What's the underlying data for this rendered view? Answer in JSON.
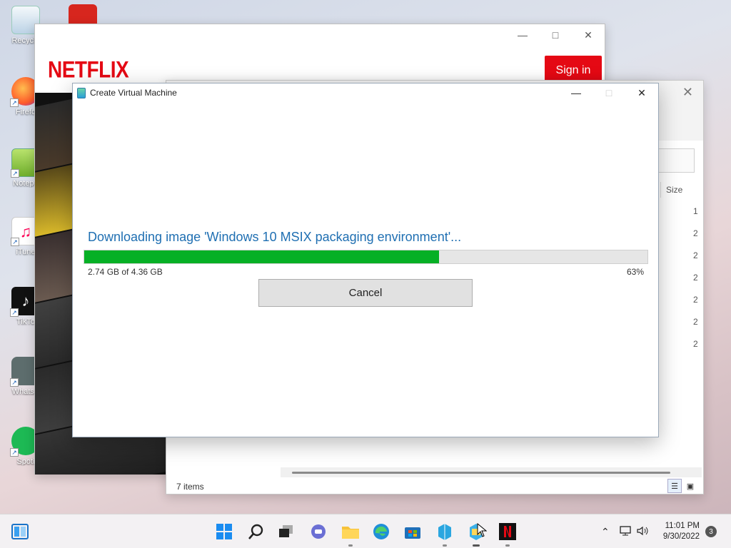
{
  "desktop": {
    "icons": [
      {
        "label": "Recycle",
        "icon": "recycle-bin-icon"
      },
      {
        "label": "Firefo",
        "icon": "firefox-icon"
      },
      {
        "label": "Notepa",
        "icon": "notepad-icon"
      },
      {
        "label": "iTune",
        "icon": "itunes-icon"
      },
      {
        "label": "TikTo",
        "icon": "tiktok-icon"
      },
      {
        "label": "WhatsA",
        "icon": "whatsapp-icon"
      },
      {
        "label": "Spoti",
        "icon": "spotify-icon"
      }
    ]
  },
  "netflix": {
    "logo": "NETFLIX",
    "sign_in": "Sign in",
    "colors": {
      "brand": "#e50914"
    }
  },
  "explorer": {
    "column_size": "Size",
    "size_values": [
      "1",
      "2",
      "2",
      "2",
      "2",
      "2",
      "2"
    ],
    "status": "7 items"
  },
  "dialog": {
    "title": "Create Virtual Machine",
    "message": "Downloading image 'Windows 10 MSIX packaging environment'...",
    "progress_text": "2.74 GB of 4.36 GB",
    "progress_percent_label": "63%",
    "progress_value": 0.63,
    "cancel_label": "Cancel",
    "colors": {
      "progress": "#06b025",
      "message": "#1f6fb2"
    }
  },
  "taskbar": {
    "apps": [
      "widgets-icon",
      "start-icon",
      "search-icon",
      "task-view-icon",
      "teams-chat-icon",
      "file-explorer-icon",
      "edge-icon",
      "store-icon",
      "msix-packaging-tool-icon",
      "hyper-v-icon",
      "netflix-icon"
    ],
    "clock_time": "11:01 PM",
    "clock_date": "9/30/2022",
    "notification_count": "3"
  }
}
